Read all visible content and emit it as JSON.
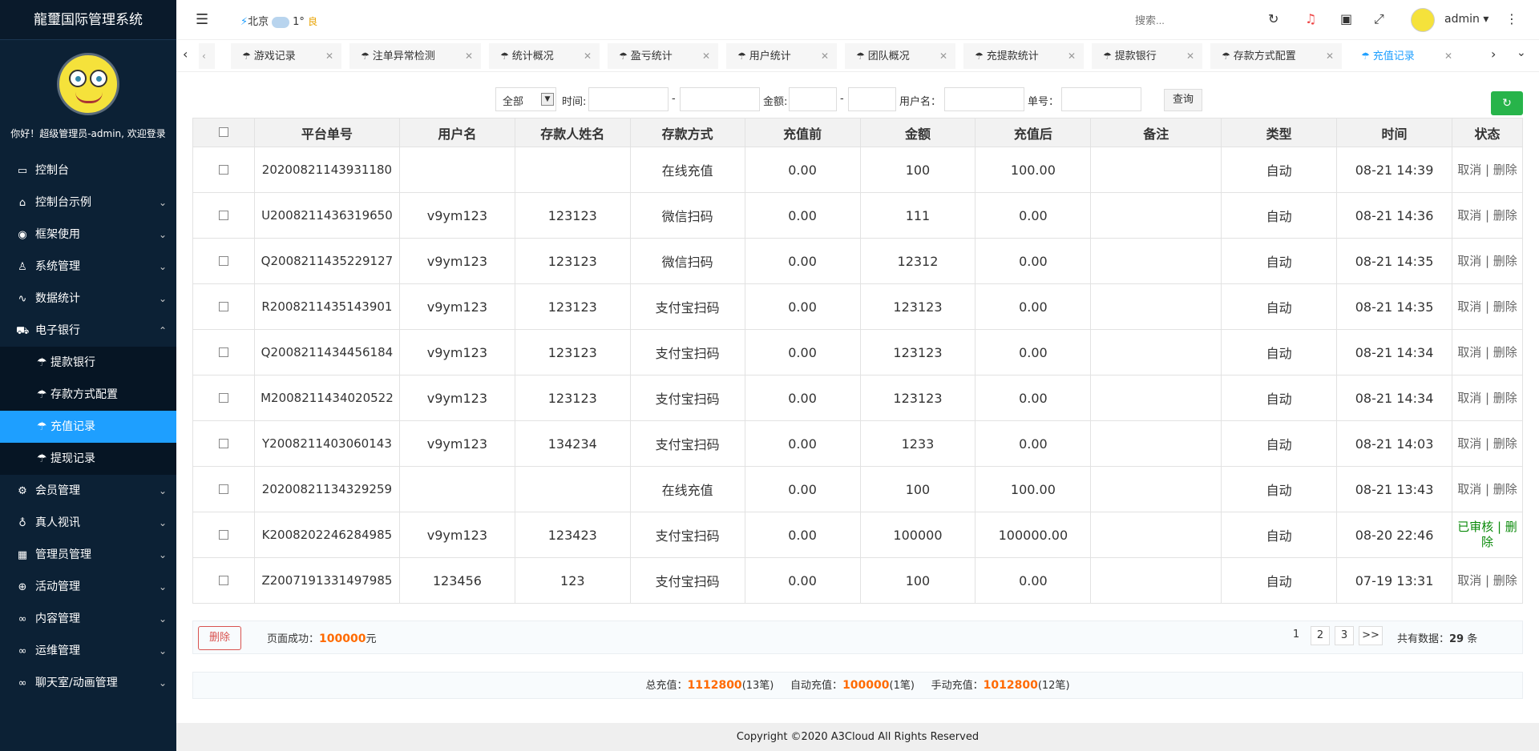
{
  "app_title": "龍璽国际管理系统",
  "welcome": "你好！超级管理员-admin, 欢迎登录",
  "menu": [
    {
      "label": "控制台",
      "icon": "monitor-icon",
      "arrow": ""
    },
    {
      "label": "控制台示例",
      "icon": "home-icon",
      "arrow": "⌄"
    },
    {
      "label": "框架使用",
      "icon": "framework-icon",
      "arrow": "⌄"
    },
    {
      "label": "系统管理",
      "icon": "user-icon",
      "arrow": "⌄"
    },
    {
      "label": "数据统计",
      "icon": "pulse-icon",
      "arrow": "⌄"
    },
    {
      "label": "电子银行",
      "icon": "car-icon",
      "arrow": "⌃"
    }
  ],
  "submenu": [
    "提款银行",
    "存款方式配置",
    "充值记录",
    "提现记录"
  ],
  "menu2": [
    {
      "label": "会员管理",
      "icon": "gear-icon",
      "arrow": "⌄"
    },
    {
      "label": "真人视讯",
      "icon": "bike-icon",
      "arrow": "⌄"
    },
    {
      "label": "管理员管理",
      "icon": "grid-icon",
      "arrow": "⌄"
    },
    {
      "label": "活动管理",
      "icon": "plus-circle-icon",
      "arrow": "⌄"
    },
    {
      "label": "内容管理",
      "icon": "infinity-icon",
      "arrow": "⌄"
    },
    {
      "label": "运维管理",
      "icon": "infinity-icon",
      "arrow": "⌄"
    },
    {
      "label": "聊天室/动画管理",
      "icon": "infinity-icon",
      "arrow": "⌄"
    }
  ],
  "topbar": {
    "city": "北京",
    "temp": "1°",
    "air": "良",
    "search_placeholder": "搜索...",
    "username": "admin"
  },
  "tabs": [
    "游戏记录",
    "注单异常检测",
    "统计概况",
    "盈亏统计",
    "用户统计",
    "团队概况",
    "充提款统计",
    "提款银行",
    "存款方式配置",
    "充值记录"
  ],
  "filter": {
    "select_value": "全部",
    "time_label": "时间:",
    "dash": "-",
    "amount_label": "金额:",
    "username_label": "用户名：",
    "order_label": "单号：",
    "query_button": "查询"
  },
  "table": {
    "headers": [
      "平台单号",
      "用户名",
      "存款人姓名",
      "存款方式",
      "充值前",
      "金额",
      "充值后",
      "备注",
      "类型",
      "时间",
      "状态"
    ],
    "rows": [
      [
        "20200821143931180",
        "",
        "",
        "在线充值",
        "0.00",
        "100",
        "100.00",
        "",
        "自动",
        "08-21 14:39",
        "取消 | 删除"
      ],
      [
        "U2008211436319650",
        "v9ym123",
        "123123",
        "微信扫码",
        "0.00",
        "111",
        "0.00",
        "",
        "自动",
        "08-21 14:36",
        "取消 | 删除"
      ],
      [
        "Q2008211435229127",
        "v9ym123",
        "123123",
        "微信扫码",
        "0.00",
        "12312",
        "0.00",
        "",
        "自动",
        "08-21 14:35",
        "取消 | 删除"
      ],
      [
        "R2008211435143901",
        "v9ym123",
        "123123",
        "支付宝扫码",
        "0.00",
        "123123",
        "0.00",
        "",
        "自动",
        "08-21 14:35",
        "取消 | 删除"
      ],
      [
        "Q2008211434456184",
        "v9ym123",
        "123123",
        "支付宝扫码",
        "0.00",
        "123123",
        "0.00",
        "",
        "自动",
        "08-21 14:34",
        "取消 | 删除"
      ],
      [
        "M2008211434020522",
        "v9ym123",
        "123123",
        "支付宝扫码",
        "0.00",
        "123123",
        "0.00",
        "",
        "自动",
        "08-21 14:34",
        "取消 | 删除"
      ],
      [
        "Y2008211403060143",
        "v9ym123",
        "134234",
        "支付宝扫码",
        "0.00",
        "1233",
        "0.00",
        "",
        "自动",
        "08-21 14:03",
        "取消 | 删除"
      ],
      [
        "20200821134329259",
        "",
        "",
        "在线充值",
        "0.00",
        "100",
        "100.00",
        "",
        "自动",
        "08-21 13:43",
        "取消 | 删除"
      ],
      [
        "K2008202246284985",
        "v9ym123",
        "123423",
        "支付宝扫码",
        "0.00",
        "100000",
        "100000.00",
        "",
        "自动",
        "08-20 22:46",
        "已审核 | 删除"
      ],
      [
        "Z2007191331497985",
        "123456",
        "123",
        "支付宝扫码",
        "0.00",
        "100",
        "0.00",
        "",
        "自动",
        "07-19 13:31",
        "取消 | 删除"
      ]
    ]
  },
  "bottom": {
    "delete_button": "删除",
    "page_success_label": "页面成功：",
    "page_success_value": "100000",
    "yuan": "元",
    "pages": [
      "1",
      "2",
      "3",
      ">>"
    ],
    "total_label": "共有数据：",
    "total_value": "29",
    "total_unit": "条"
  },
  "summary": {
    "total_label": "总充值：",
    "total": "1112800",
    "total_count": "(13笔)",
    "auto_label": "自动充值：",
    "auto": "100000",
    "auto_count": "(1笔)",
    "manual_label": "手动充值：",
    "manual": "1012800",
    "manual_count": "(12笔)"
  },
  "footer": "Copyright ©2020 A3Cloud All Rights Reserved",
  "colors": {
    "sidebar": "#0c2135",
    "accent": "#1e9fff",
    "orange": "#ff6a00",
    "green": "#27b44a"
  }
}
